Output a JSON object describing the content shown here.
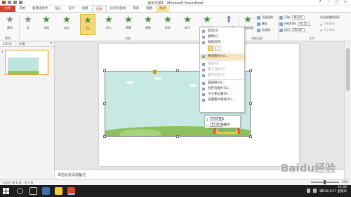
{
  "window": {
    "title": "演示文稿1 - Microsoft PowerPoint",
    "controls": [
      "?",
      "–",
      "□",
      "×"
    ]
  },
  "ribbon_tabs": [
    "文件",
    "开始",
    "新建选项卡",
    "插入",
    "设计",
    "切换",
    "动画",
    "幻灯片放映",
    "审阅",
    "视图",
    "格式"
  ],
  "ribbon": {
    "preview_label": "预览",
    "effects": [
      {
        "label": "无"
      },
      {
        "label": "出现"
      },
      {
        "label": "淡出"
      },
      {
        "label": "飞入"
      },
      {
        "label": "浮入"
      },
      {
        "label": "劈裂"
      },
      {
        "label": "擦除"
      },
      {
        "label": "形状"
      },
      {
        "label": "轮子"
      },
      {
        "label": "随机线条"
      }
    ],
    "effect_options_label": "效果选项",
    "add_animation_label": "添加动画",
    "animation_pane": "动画窗格",
    "trigger": "触发",
    "animation_painter": "动画刷",
    "start_label": "开始:",
    "start_value": "单击时",
    "duration_label": "持续时间:",
    "duration_value": "00.50",
    "delay_label": "延迟:",
    "delay_value": "00.00",
    "reorder_label": "对动画重新排序",
    "move_earlier": "向前移动",
    "move_later": "向后移动",
    "groups": [
      "预览",
      "动画",
      "高级动画",
      "计时"
    ]
  },
  "left_pane": {
    "tabs": [
      "幻灯片",
      "大纲"
    ],
    "slide_number": "1"
  },
  "context_menu": {
    "items": [
      {
        "label": "剪切(T)",
        "disabled": false
      },
      {
        "label": "复制(C)",
        "disabled": false
      },
      {
        "label": "粘贴选项:",
        "disabled": false
      },
      {
        "label": "更改图片(A)...",
        "disabled": false
      },
      {
        "label": "组合(G)",
        "disabled": true
      },
      {
        "label": "置于顶层(R)",
        "disabled": true
      },
      {
        "label": "置于底层(K)",
        "disabled": true
      },
      {
        "label": "超链接(H)...",
        "disabled": false
      },
      {
        "label": "另存为图片(S)...",
        "disabled": false
      },
      {
        "label": "大小和位置(Z)...",
        "disabled": false
      },
      {
        "label": "设置图片格式(O)...",
        "disabled": false
      }
    ]
  },
  "mini_toolbar": {
    "height_value": "9.34 厘米",
    "width_value": "12.46 厘米",
    "crop_label": "裁剪"
  },
  "notes_placeholder": "单击此处添加备注",
  "statusbar": {
    "left": "幻灯片 第 1 张，共 1 张",
    "zoom": "69%"
  },
  "taskbar": {
    "time": "22:00",
    "date": "2019/1/27 星期日",
    "lang": "中"
  },
  "watermark": "Baidu经验",
  "colors": {
    "file_tab": "#d24726",
    "selected_effect": "#f7d774",
    "animation_star": "#4a8f3c"
  }
}
